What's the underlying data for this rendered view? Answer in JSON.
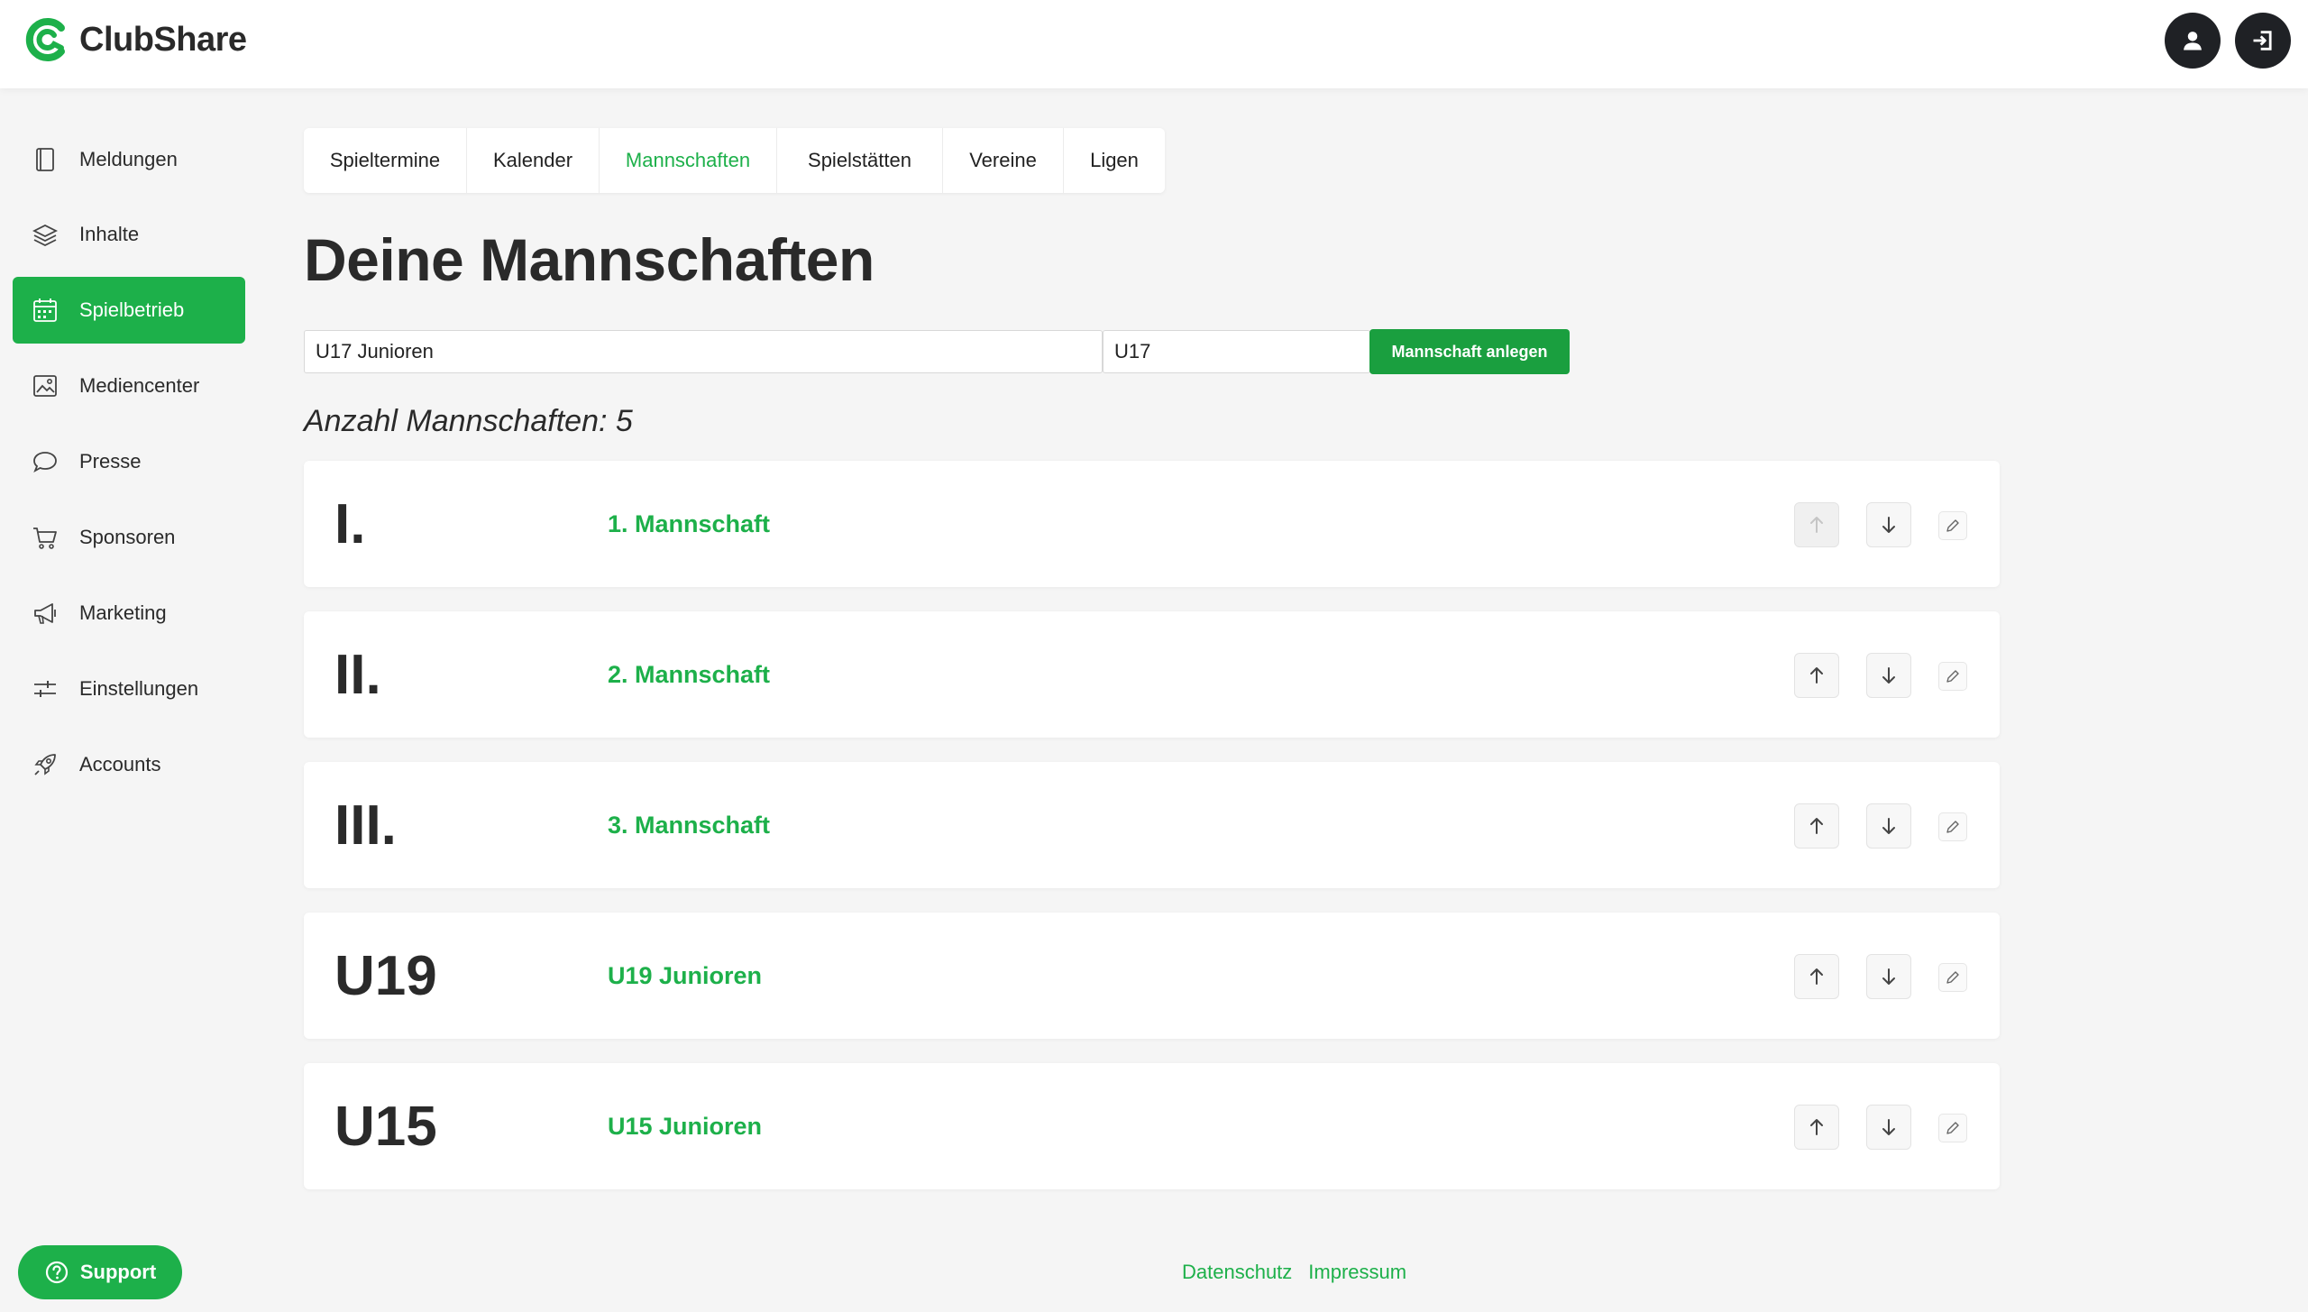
{
  "app": {
    "name": "ClubShare",
    "brand_color": "#1db04a"
  },
  "header": {
    "profile_icon": "user-icon",
    "logout_icon": "logout-icon"
  },
  "sidebar": {
    "items": [
      {
        "label": "Meldungen",
        "icon": "book-icon"
      },
      {
        "label": "Inhalte",
        "icon": "layers-icon"
      },
      {
        "label": "Spielbetrieb",
        "icon": "calendar-icon",
        "active": true
      },
      {
        "label": "Mediencenter",
        "icon": "image-icon"
      },
      {
        "label": "Presse",
        "icon": "chat-bubble-icon"
      },
      {
        "label": "Sponsoren",
        "icon": "cart-icon"
      },
      {
        "label": "Marketing",
        "icon": "megaphone-icon"
      },
      {
        "label": "Einstellungen",
        "icon": "sliders-icon"
      },
      {
        "label": "Accounts",
        "icon": "rocket-icon"
      }
    ],
    "support_label": "Support"
  },
  "tabs": [
    {
      "label": "Spieltermine"
    },
    {
      "label": "Kalender"
    },
    {
      "label": "Mannschaften",
      "active": true
    },
    {
      "label": "Spielstätten"
    },
    {
      "label": "Vereine"
    },
    {
      "label": "Ligen"
    }
  ],
  "main": {
    "title": "Deine Mannschaften",
    "form": {
      "name_value": "U17 Junioren",
      "short_value": "U17",
      "create_label": "Mannschaft anlegen"
    },
    "count_label": "Anzahl Mannschaften: 5",
    "teams": [
      {
        "abbr": "I.",
        "name": "1. Mannschaft",
        "up_disabled": true
      },
      {
        "abbr": "II.",
        "name": "2. Mannschaft"
      },
      {
        "abbr": "III.",
        "name": "3. Mannschaft"
      },
      {
        "abbr": "U19",
        "name": "U19 Junioren"
      },
      {
        "abbr": "U15",
        "name": "U15 Junioren"
      }
    ]
  },
  "footer": {
    "privacy": "Datenschutz",
    "imprint": "Impressum"
  }
}
